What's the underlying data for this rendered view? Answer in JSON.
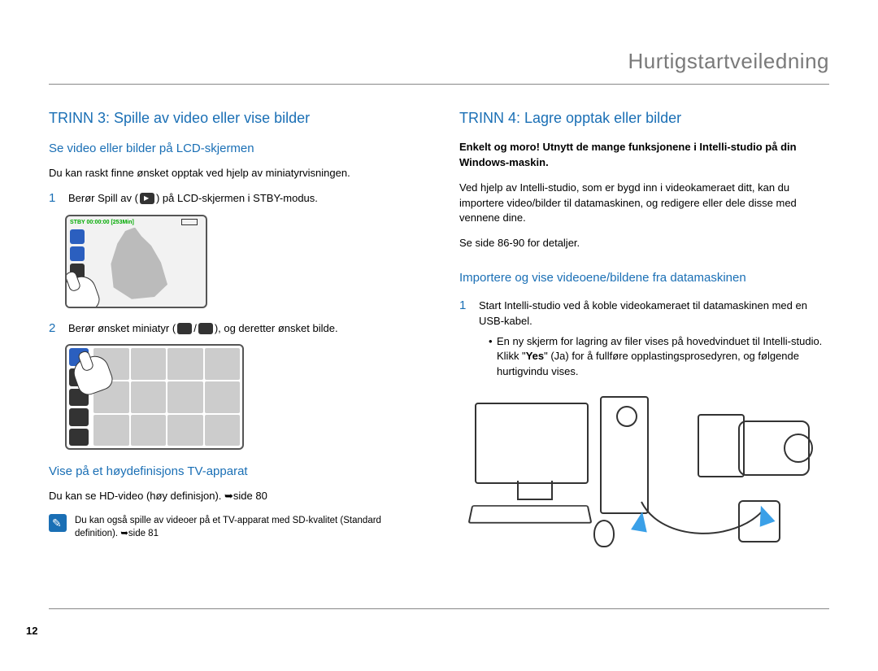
{
  "header": {
    "title": "Hurtigstartveiledning"
  },
  "left": {
    "step_heading": "TRINN 3: Spille av video eller vise bilder",
    "sub1": "Se video eller bilder på LCD-skjermen",
    "intro": "Du kan raskt finne ønsket opptak ved hjelp av miniatyrvisningen.",
    "item1_before": "Berør Spill av (",
    "item1_after": ") på LCD-skjermen i STBY-modus.",
    "thumb_status": "STBY 00:00:00 [253Min]",
    "item2_before": "Berør ønsket miniatyr (",
    "item2_mid": "/",
    "item2_after": "), og deretter ønsket bilde.",
    "sub2": "Vise på et høydefinisjons TV-apparat",
    "hd_text": "Du kan se HD-video (høy definisjon). ➥side 80",
    "note": "Du kan også spille av videoer på et TV-apparat med SD-kvalitet (Standard definition). ➥side 81"
  },
  "right": {
    "step_heading": "TRINN 4: Lagre opptak eller bilder",
    "bold_intro": "Enkelt og moro! Utnytt de mange funksjonene i Intelli-studio på din Windows-maskin.",
    "p1": "Ved hjelp av Intelli-studio, som er bygd inn i videokameraet ditt, kan du importere video/bilder til datamaskinen, og redigere eller dele disse med vennene dine.",
    "p2": "Se side 86-90 for detaljer.",
    "sub1": "Importere og vise videoene/bildene fra datamaskinen",
    "item1": "Start Intelli-studio ved å koble videokameraet til datamaskinen med en USB-kabel.",
    "bullet_a": "En ny skjerm for lagring av filer vises på hovedvinduet til Intelli-studio. Klikk \"",
    "bullet_yes": "Yes",
    "bullet_b": "\" (Ja) for å fullføre opplastingsprosedyren, og følgende hurtigvindu vises."
  },
  "page_number": "12"
}
